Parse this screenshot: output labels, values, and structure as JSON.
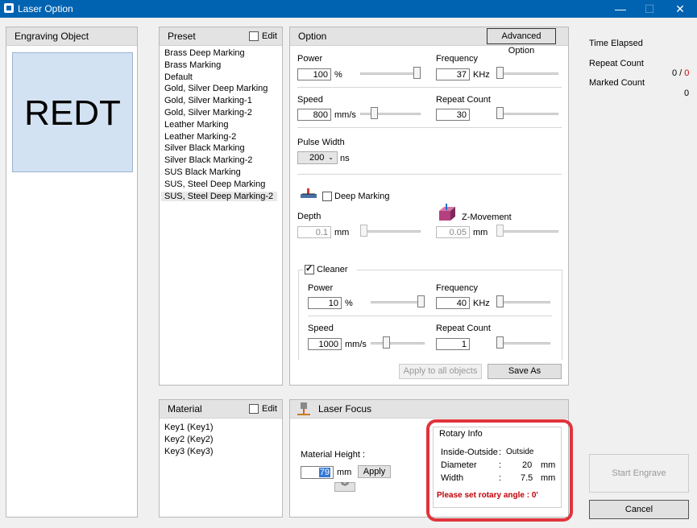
{
  "window": {
    "title": "Laser Option",
    "minimize": "—",
    "maximize": "☐",
    "close": "✕"
  },
  "engraving": {
    "header": "Engraving Object",
    "preview_text": "REDT"
  },
  "preset": {
    "header": "Preset",
    "edit_label": "Edit",
    "items": [
      "Brass Deep Marking",
      "Brass Marking",
      "Default",
      "Gold, Silver Deep Marking",
      "Gold, Silver Marking-1",
      "Gold, Silver Marking-2",
      "Leather Marking",
      "Leather Marking-2",
      "Silver Black Marking",
      "Silver Black Marking-2",
      "SUS Black Marking",
      "SUS, Steel Deep Marking",
      "SUS, Steel Deep Marking-2"
    ],
    "selected_index": 12
  },
  "option": {
    "header": "Option",
    "advanced_button": "Advanced Option",
    "power": {
      "label": "Power",
      "value": "100",
      "unit": "%",
      "level": 1.0
    },
    "frequency": {
      "label": "Frequency",
      "value": "37",
      "unit": "KHz",
      "level": 0.0
    },
    "speed": {
      "label": "Speed",
      "value": "800",
      "unit": "mm/s",
      "level": 0.2
    },
    "repeat": {
      "label": "Repeat Count",
      "value": "30",
      "level": 0.0
    },
    "pulse": {
      "label": "Pulse Width",
      "value": "200",
      "unit": "ns"
    },
    "deep_marking": {
      "label": "Deep Marking",
      "checked": false
    },
    "depth": {
      "label": "Depth",
      "value": "0.1",
      "unit": "mm",
      "level": 0.0
    },
    "zmove": {
      "label": "Z-Movement",
      "value": "0.05",
      "unit": "mm",
      "level": 0.0
    },
    "cleaner": {
      "label": "Cleaner",
      "checked": true,
      "power": {
        "label": "Power",
        "value": "10",
        "unit": "%",
        "level": 1.0
      },
      "frequency": {
        "label": "Frequency",
        "value": "40",
        "unit": "KHz",
        "level": 0.0
      },
      "speed": {
        "label": "Speed",
        "value": "1000",
        "unit": "mm/s",
        "level": 0.25
      },
      "repeat": {
        "label": "Repeat Count",
        "value": "1",
        "level": 0.0
      }
    },
    "apply_all": "Apply to all objects",
    "save_as": "Save As"
  },
  "material": {
    "header": "Material",
    "edit_label": "Edit",
    "items": [
      "Key1 (Key1)",
      "Key2 (Key2)",
      "Key3 (Key3)"
    ]
  },
  "focus": {
    "header": "Laser Focus",
    "height_label": "Material Height :",
    "height_value": "79",
    "unit": "mm",
    "apply": "Apply",
    "expand": "︾"
  },
  "rotary": {
    "title": "Rotary Info",
    "inside_label": "Inside-Outside",
    "inside_sep": ":",
    "inside_value": "Outside",
    "diameter_label": "Diameter",
    "diameter_sep": ":",
    "diameter_value": "20",
    "diameter_unit": "mm",
    "width_label": "Width",
    "width_sep": ":",
    "width_value": "7.5",
    "width_unit": "mm",
    "warning": "Please set rotary angle : 0'",
    "highlight_color": "#e0343c"
  },
  "status": {
    "time_elapsed": "Time Elapsed",
    "repeat_count": "Repeat Count",
    "repeat_done": "0",
    "repeat_sep": " / ",
    "repeat_total": "0",
    "marked_count": "Marked Count",
    "marked_value": "0"
  },
  "actions": {
    "start": "Start Engrave",
    "cancel": "Cancel"
  }
}
